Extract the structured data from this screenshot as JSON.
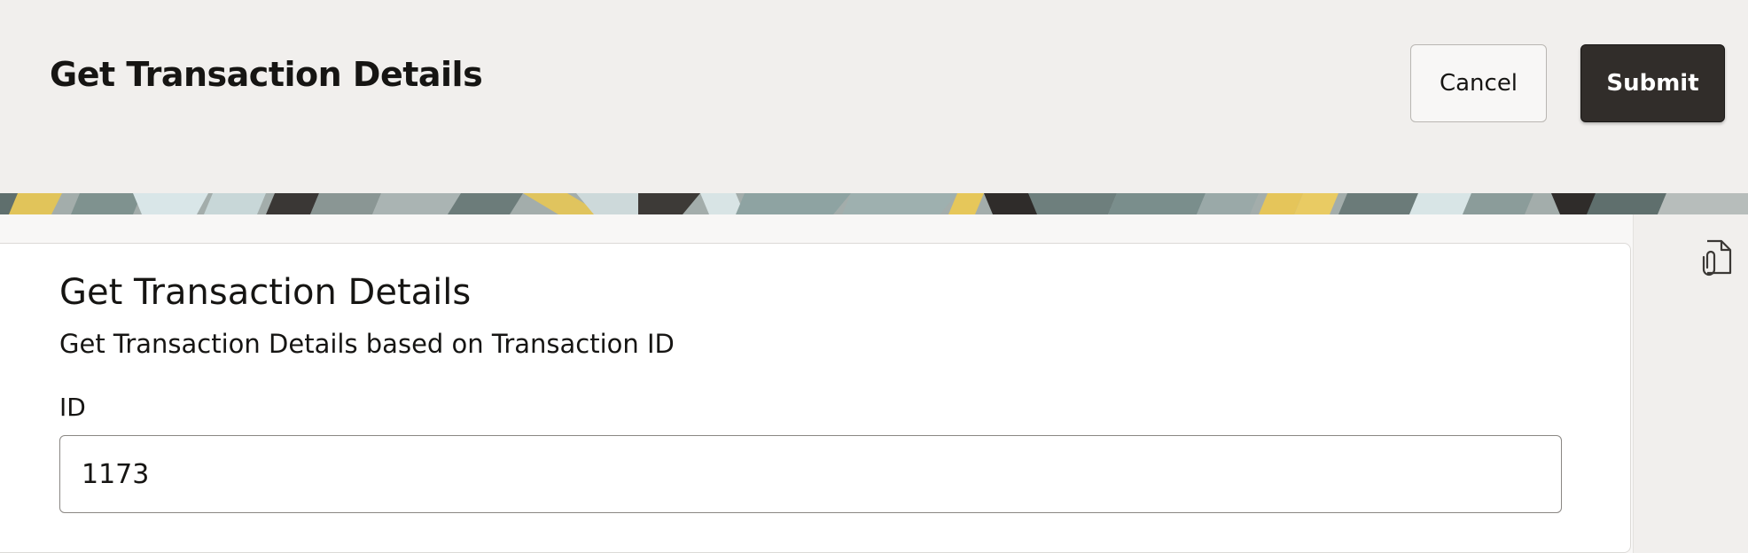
{
  "header": {
    "title": "Get Transaction Details",
    "cancel_label": "Cancel",
    "submit_label": "Submit"
  },
  "card": {
    "title": "Get Transaction Details",
    "subtitle": "Get Transaction Details based on Transaction ID",
    "field": {
      "label": "ID",
      "value": "1173"
    }
  },
  "side_rail": {
    "icon": "attachment-document-icon"
  },
  "colors": {
    "header_bg": "#f1efed",
    "submit_bg": "#312d2a",
    "banner_yellow": "#e7c14f",
    "banner_teal": "#6f8482"
  }
}
